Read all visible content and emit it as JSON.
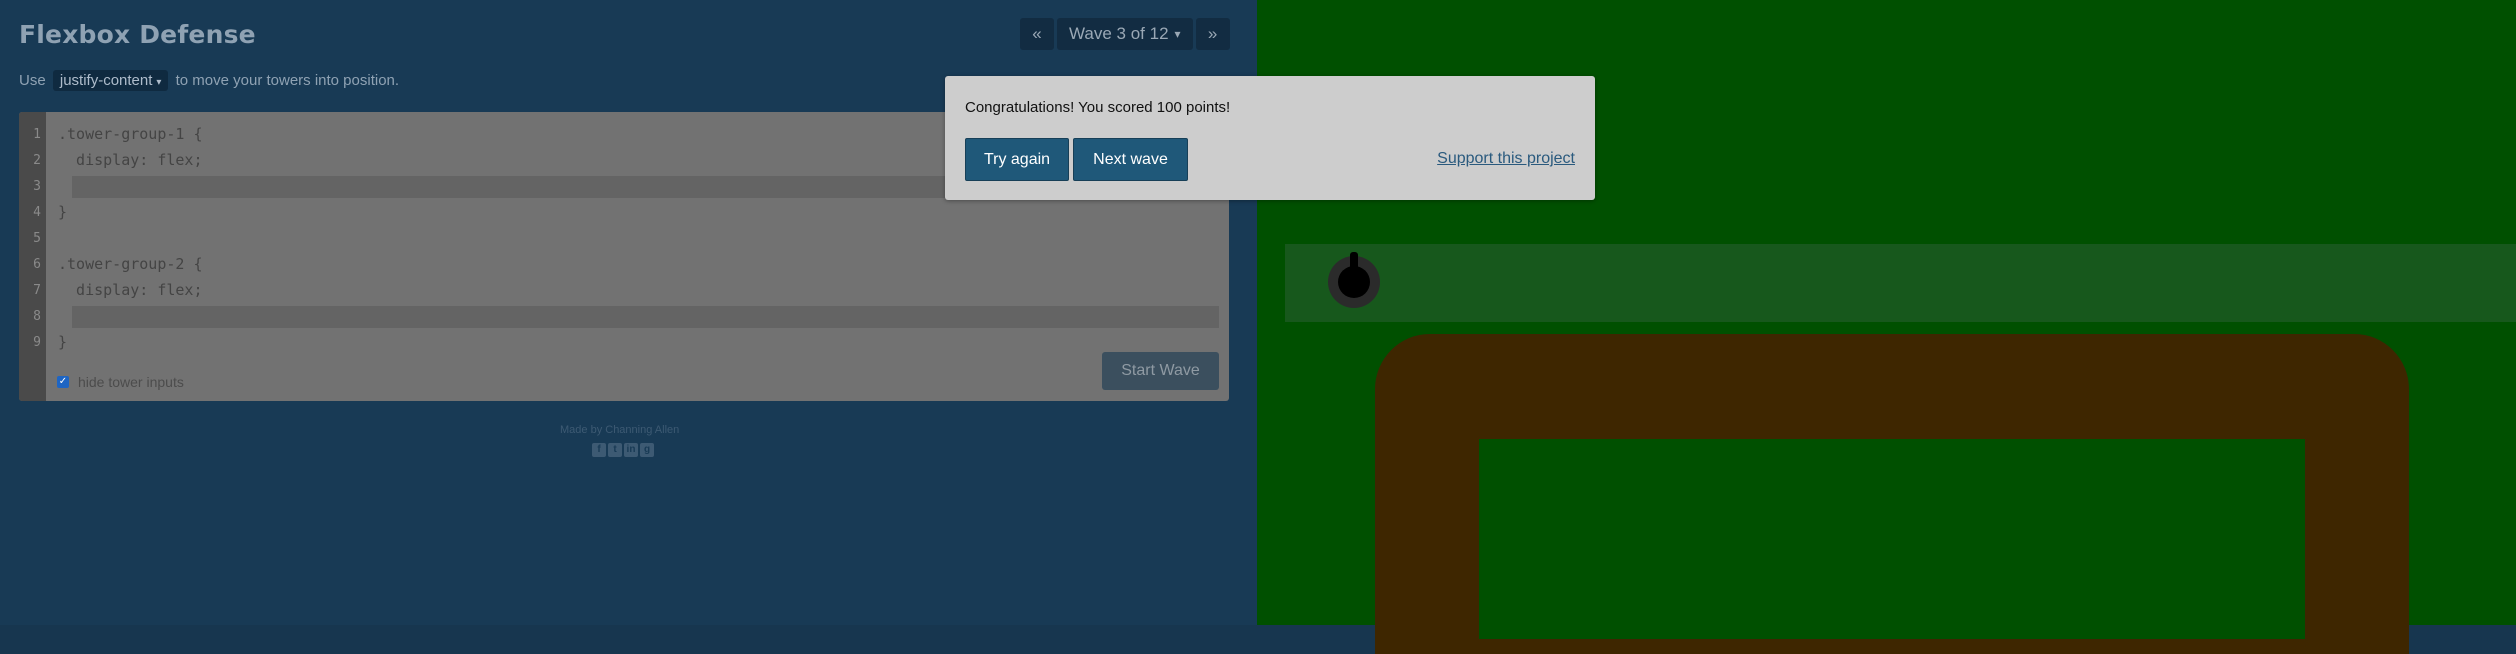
{
  "header": {
    "title": "Flexbox Defense"
  },
  "wave_nav": {
    "prev": "«",
    "label": "Wave 3 of 12",
    "caret": "▾",
    "next": "»"
  },
  "instructions": {
    "before": "Use",
    "property": "justify-content",
    "caret": "▾",
    "after": "to move your towers into position."
  },
  "editor": {
    "line_numbers": [
      "1",
      "2",
      "3",
      "4",
      "5",
      "6",
      "7",
      "8",
      "9"
    ],
    "lines": [
      ".tower-group-1 {",
      "  display: flex;",
      "",
      "}",
      "",
      ".tower-group-2 {",
      "  display: flex;",
      "",
      "}"
    ],
    "start_button": "Start Wave",
    "hide_inputs_label": "hide tower inputs",
    "hide_inputs_checked": true
  },
  "footer": {
    "credit": "Made by Channing Allen",
    "icons": [
      "facebook-icon",
      "twitter-icon",
      "linkedin-icon",
      "github-icon"
    ]
  },
  "modal": {
    "message": "Congratulations! You scored 100 points!",
    "try_again": "Try again",
    "next_wave": "Next wave",
    "support": "Support this project"
  },
  "colors": {
    "board": "#005000",
    "path": "#3e2600",
    "lane": "#17581c",
    "button": "#1f5879"
  }
}
